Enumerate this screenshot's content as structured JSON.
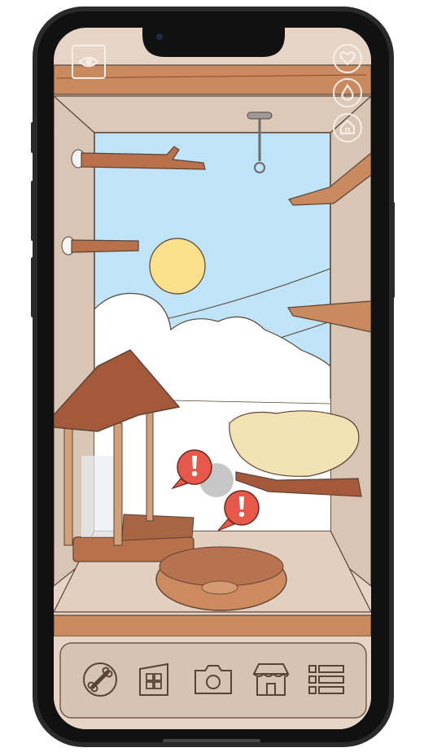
{
  "colors": {
    "frame": "#1b1b1b",
    "wall": "#e3d2c3",
    "wall_shadow": "#c9b3a1",
    "wood": "#b8714a",
    "wood_dark": "#8a4a2c",
    "sky": "#bfe3f7",
    "sun": "#fbe08c",
    "alert": "#e5584a",
    "toolbar": "#d7c3b1",
    "icon_outline": "#f6efe7"
  },
  "top_left_icon": "eye-icon",
  "top_right_icons": [
    "heart-icon",
    "water-drop-icon",
    "house-icon"
  ],
  "alerts": [
    {
      "icon": "exclamation-icon"
    },
    {
      "icon": "exclamation-icon"
    }
  ],
  "toolbar": {
    "items": [
      {
        "icon": "bone-icon"
      },
      {
        "icon": "grid-building-icon"
      },
      {
        "icon": "camera-icon"
      },
      {
        "icon": "shop-icon"
      },
      {
        "icon": "list-icon"
      }
    ]
  }
}
